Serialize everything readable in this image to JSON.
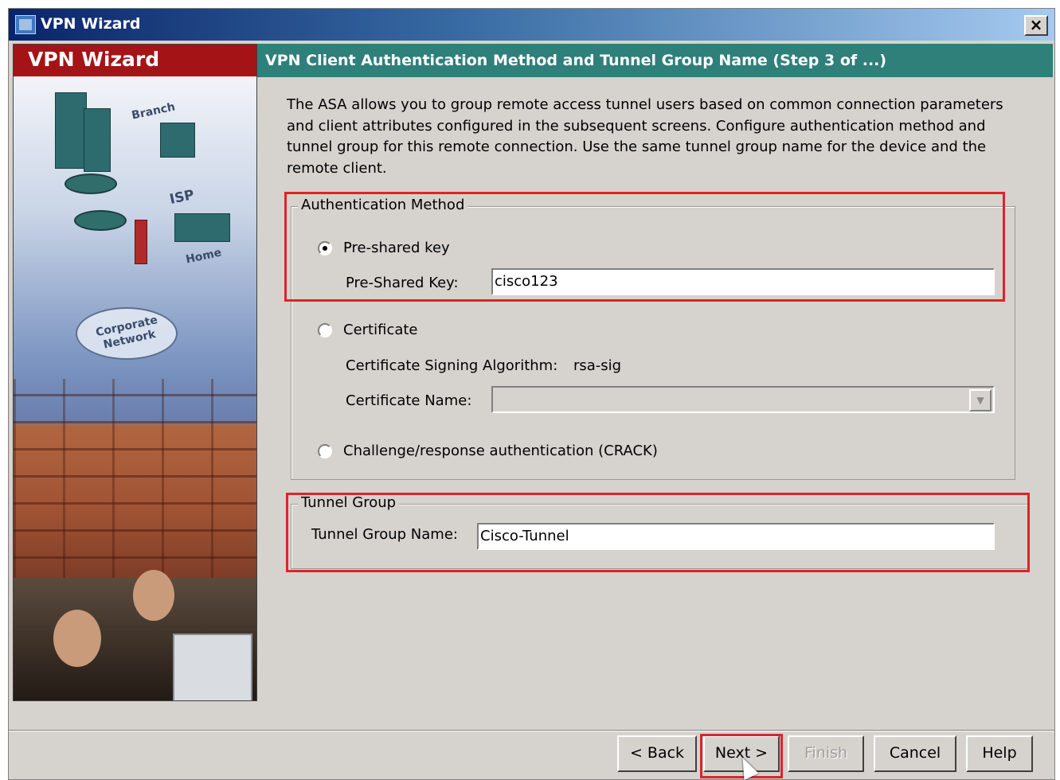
{
  "window": {
    "title": "VPN Wizard",
    "close_label": "×"
  },
  "sidebar": {
    "header": "VPN Wizard",
    "art_labels": {
      "branch": "Branch",
      "isp": "ISP",
      "home": "Home",
      "corporate": "Corporate Network"
    }
  },
  "step": {
    "title": "VPN Client Authentication Method and Tunnel Group Name  (Step 3 of ...)"
  },
  "description": "The ASA allows you to group remote access tunnel users based on common connection parameters and client attributes configured in the subsequent screens. Configure authentication method and tunnel group for this remote connection. Use the same tunnel group name for the device and the remote client.",
  "auth": {
    "legend": "Authentication Method",
    "psk_radio_label": "Pre-shared key",
    "psk_field_label": "Pre-Shared Key:",
    "psk_value": "cisco123",
    "cert_radio_label": "Certificate",
    "cert_alg_label": "Certificate Signing Algorithm:",
    "cert_alg_value": "rsa-sig",
    "cert_name_label": "Certificate Name:",
    "cert_name_value": "",
    "crack_radio_label": "Challenge/response authentication (CRACK)",
    "selected": "pre-shared-key"
  },
  "tunnel": {
    "legend": "Tunnel Group",
    "name_label": "Tunnel Group Name:",
    "name_value": "Cisco-Tunnel"
  },
  "buttons": {
    "back": "< Back",
    "next": "Next >",
    "finish": "Finish",
    "cancel": "Cancel",
    "help": "Help"
  },
  "colors": {
    "highlight": "#d9262a",
    "step_header": "#2f7f7b",
    "side_header": "#a41416",
    "window_bg": "#d6d3ce"
  }
}
